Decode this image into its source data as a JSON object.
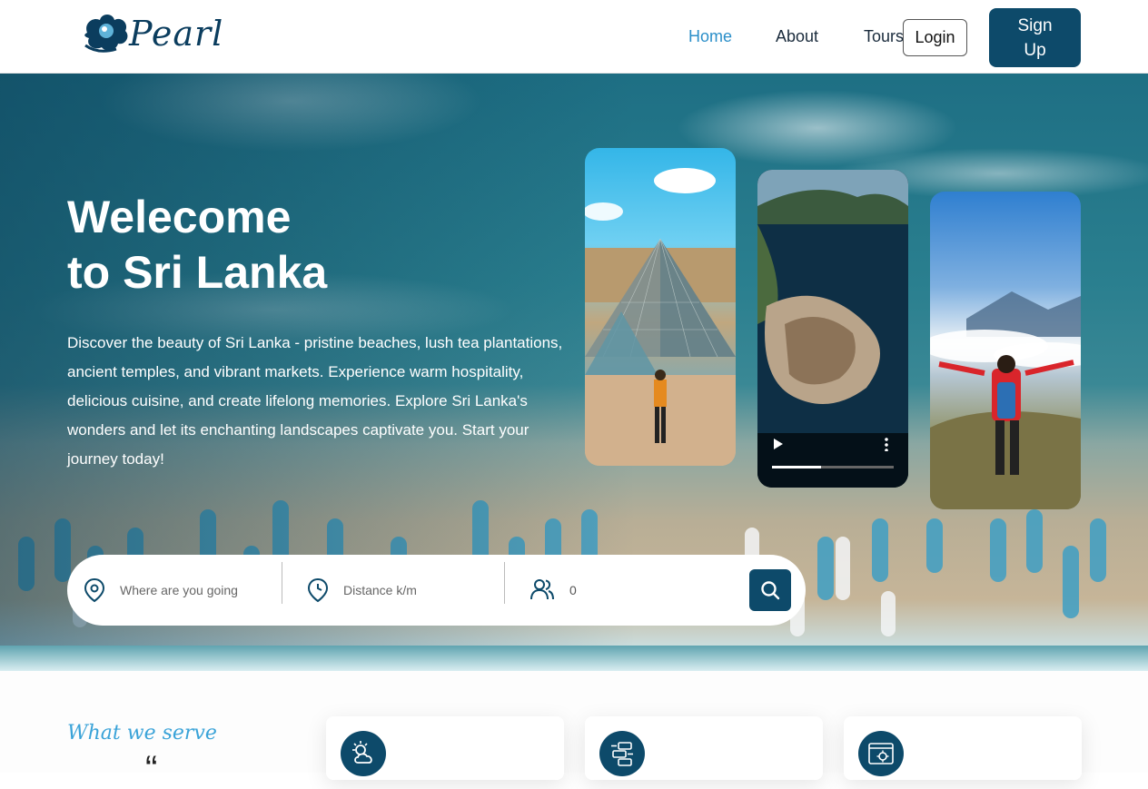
{
  "header": {
    "logo_text": "Pearl",
    "nav": [
      "Home",
      "About",
      "Tours"
    ],
    "active_nav": "Home",
    "login_label": "Login",
    "signup_label": "Sign Up"
  },
  "hero": {
    "title_line1": "Welecome",
    "title_line2": "to Sri Lanka",
    "description": "Discover the beauty of Sri Lanka - pristine beaches, lush tea plantations, ancient temples, and vibrant markets. Experience warm hospitality, delicious cuisine, and create lifelong memories. Explore Sri Lanka's wonders and let its enchanting landscapes captivate you. Start your journey today!",
    "video_progress": 0.4
  },
  "search": {
    "location_placeholder": "Where are you going",
    "distance_placeholder": "Distance k/m",
    "people_value": "0",
    "icons": [
      "map-pin-icon",
      "clock-icon",
      "users-icon",
      "search-icon"
    ]
  },
  "services": {
    "section_title": "What we serve",
    "cards": [
      {
        "icon": "weather-icon"
      },
      {
        "icon": "guide-icon"
      },
      {
        "icon": "customization-icon"
      }
    ]
  },
  "colors": {
    "primary": "#0d4a6a",
    "accent": "#2b8fc9",
    "script_accent": "#3aa3d8"
  }
}
